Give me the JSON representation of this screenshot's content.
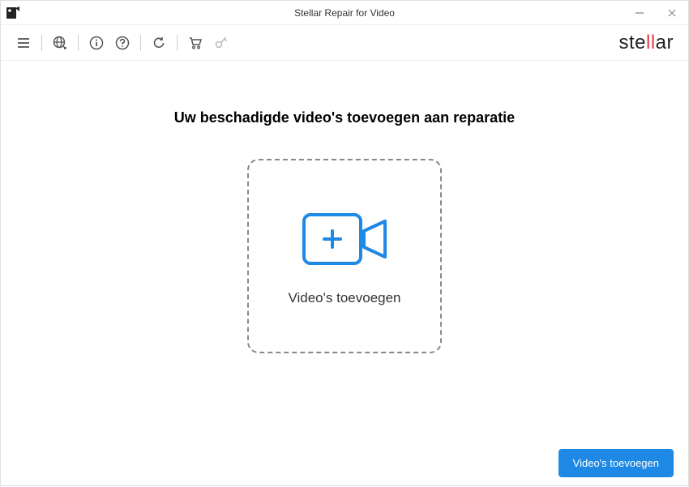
{
  "titlebar": {
    "title": "Stellar Repair for Video"
  },
  "brand": {
    "prefix": "ste",
    "accent": "ll",
    "suffix": "ar"
  },
  "main": {
    "title": "Uw beschadigde video's toevoegen aan reparatie",
    "dropzone_label": "Video's toevoegen"
  },
  "footer": {
    "add_button_label": "Video's toevoegen"
  }
}
